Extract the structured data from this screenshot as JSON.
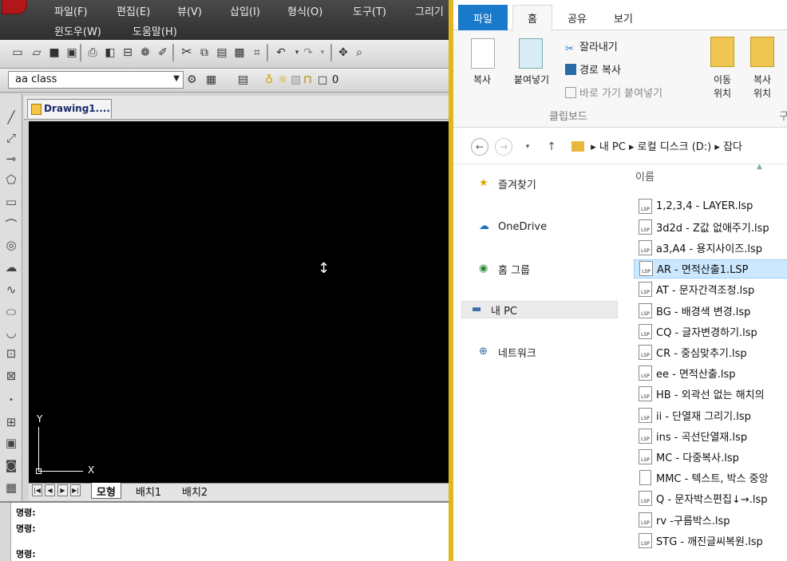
{
  "cad": {
    "menu_row1": [
      "파일(F)",
      "편집(E)",
      "뷰(V)",
      "삽입(I)",
      "형식(O)",
      "도구(T)",
      "그리기"
    ],
    "menu_row2": [
      "윈도우(W)",
      "도움말(H)"
    ],
    "layer_select_value": "aa class",
    "layer_state_label": "0",
    "drawing_tab_label": "Drawing1....",
    "axis_y_label": "Y",
    "axis_x_label": "X",
    "layout_tabs": [
      "모형",
      "배치1",
      "배치2"
    ],
    "command_lines": [
      "명령:",
      "명령:",
      "명령:"
    ]
  },
  "explorer": {
    "tabs": {
      "file": "파일",
      "home": "홈",
      "share": "공유",
      "view": "보기"
    },
    "ribbon": {
      "copy": "복사",
      "paste": "붙여넣기",
      "cut": "잘라내기",
      "copy_path": "경로 복사",
      "paste_shortcut": "바로 가기 붙여넣기",
      "move_to": "이동",
      "move_to_sub": "위치",
      "copy_to": "복사",
      "copy_to_sub": "위치",
      "group_clipboard": "클립보드",
      "group_organize": "구"
    },
    "address": {
      "path": [
        "내 PC",
        "로컬 디스크 (D:)",
        "잡다"
      ]
    },
    "nav": {
      "favorites": "즐겨찾기",
      "onedrive": "OneDrive",
      "homegroup": "홈 그룹",
      "thispc": "내 PC",
      "network": "네트워크"
    },
    "column_name": "이름",
    "files": [
      "1,2,3,4 - LAYER.lsp",
      "3d2d - Z값 없애주기.lsp",
      "a3,A4 - 용지사이즈.lsp",
      "AR - 면적산출1.LSP",
      "AT - 문자간격조정.lsp",
      "BG - 배경색 변경.lsp",
      "CQ - 글자변경하기.lsp",
      "CR - 중심맞추기.lsp",
      "ee - 면적산출.lsp",
      "HB - 외곽선 없는 해치의",
      "ii - 단열재 그리기.lsp",
      "ins - 곡선단열재.lsp",
      "MC - 다중복사.lsp",
      "MMC - 텍스트, 박스 중앙",
      "Q - 문자박스편집↓→.lsp",
      "rv -구름박스.lsp",
      "STG - 깨진글씨복원.lsp"
    ],
    "selected_file_index": 3,
    "file_icon_label": "LSP"
  },
  "colors": {
    "accent": "#1979ca",
    "selection": "#cce8ff",
    "canvas": "#000000"
  }
}
